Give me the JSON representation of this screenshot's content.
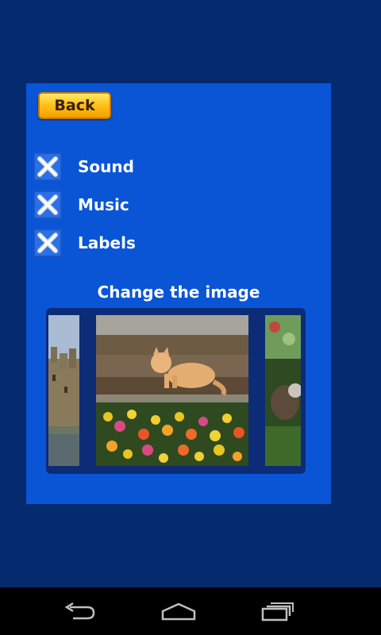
{
  "back_button": {
    "label": "Back"
  },
  "options": [
    {
      "label": "Sound",
      "checked": true
    },
    {
      "label": "Music",
      "checked": true
    },
    {
      "label": "Labels",
      "checked": true
    }
  ],
  "image_picker": {
    "title": "Change the image",
    "images": [
      {
        "icon": "castle-image"
      },
      {
        "icon": "cat-flowers-image",
        "selected": true
      },
      {
        "icon": "garden-image"
      }
    ]
  },
  "nav_bar": {
    "back_icon": "back-arrow-icon",
    "home_icon": "home-icon",
    "recents_icon": "recent-apps-icon"
  }
}
